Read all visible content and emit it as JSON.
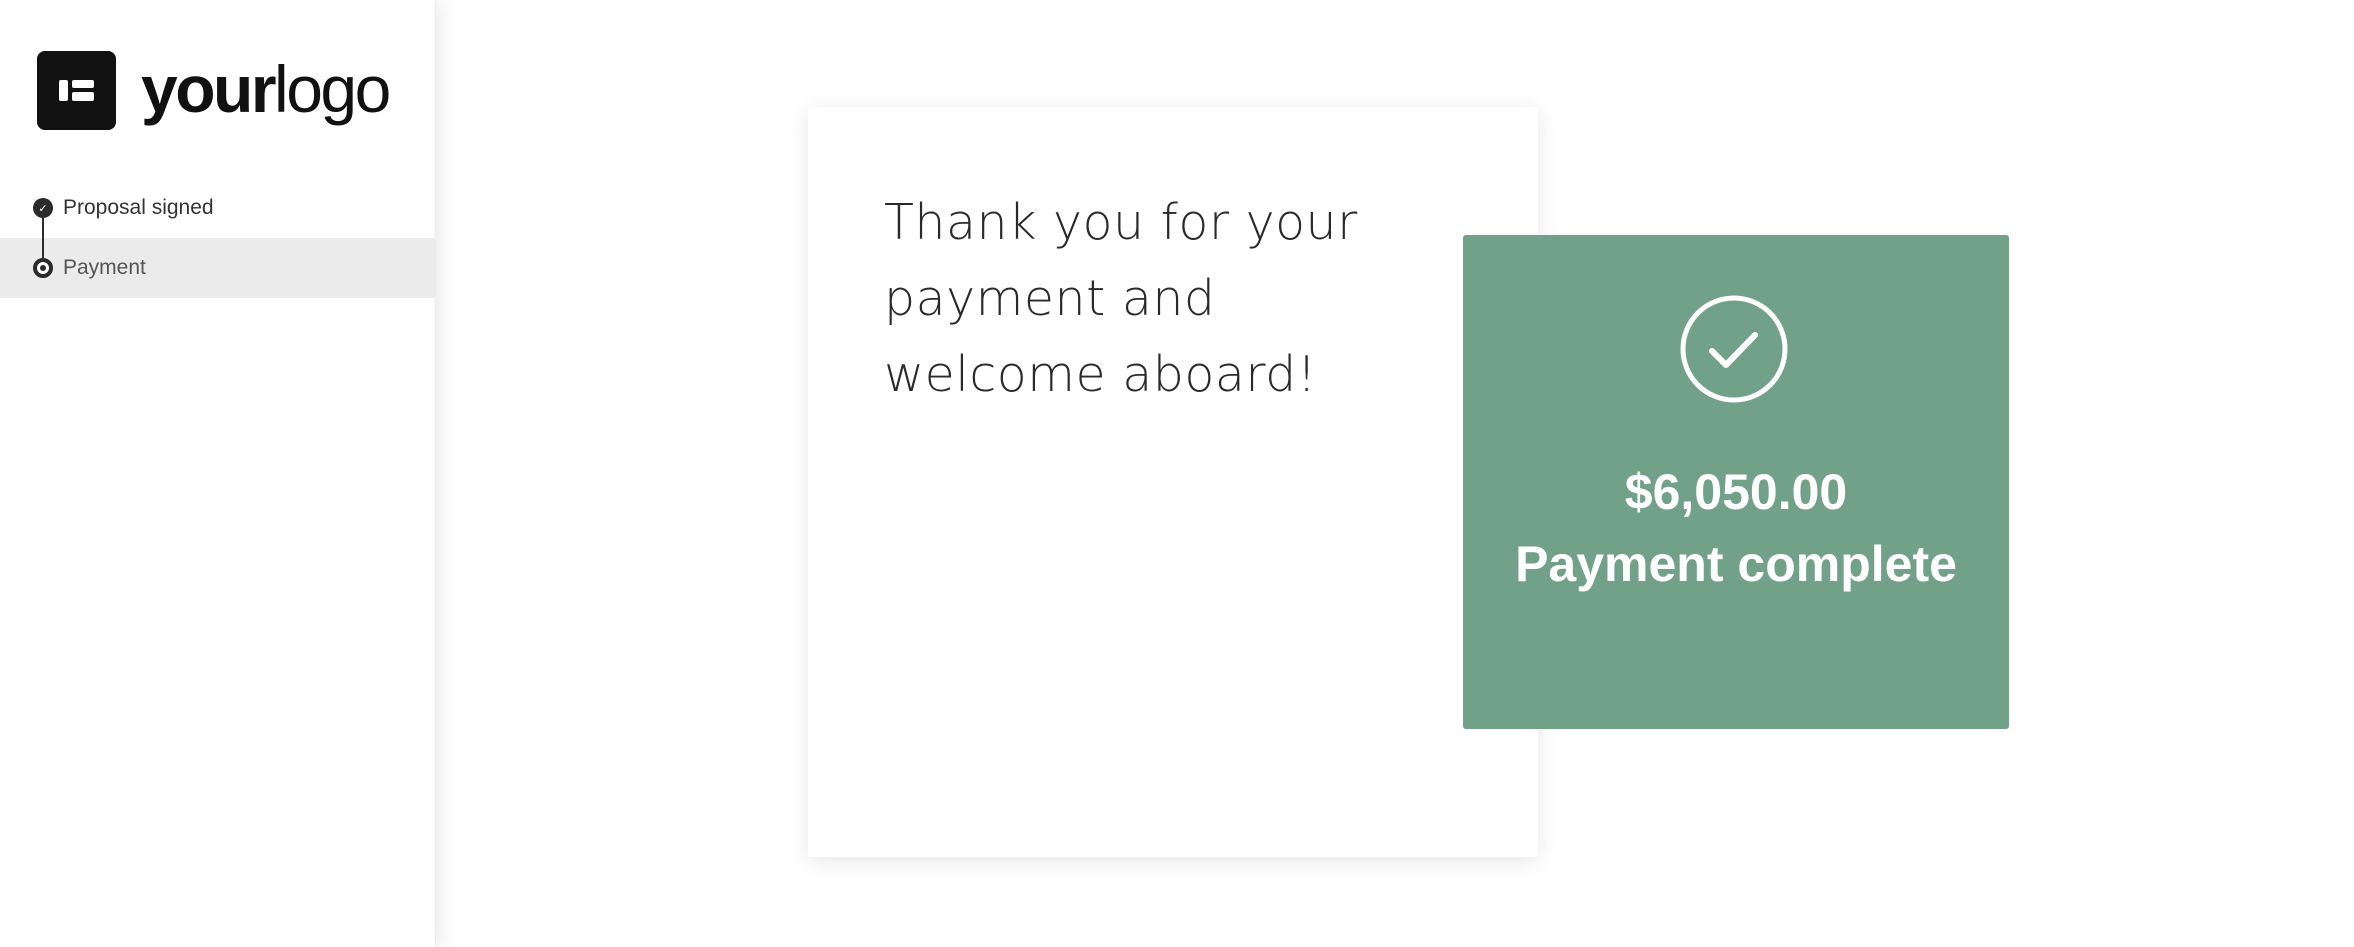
{
  "logo": {
    "bold_text": "your",
    "light_text": "logo"
  },
  "steps": [
    {
      "label": "Proposal signed",
      "state": "complete",
      "icon": "check-icon"
    },
    {
      "label": "Payment",
      "state": "current",
      "icon": "dot-icon"
    }
  ],
  "message": {
    "text": "Thank you for your payment and welcome aboard!"
  },
  "payment": {
    "amount": "$6,050.00",
    "status": "Payment complete",
    "icon": "check-circle-icon",
    "color": "#72a189"
  }
}
